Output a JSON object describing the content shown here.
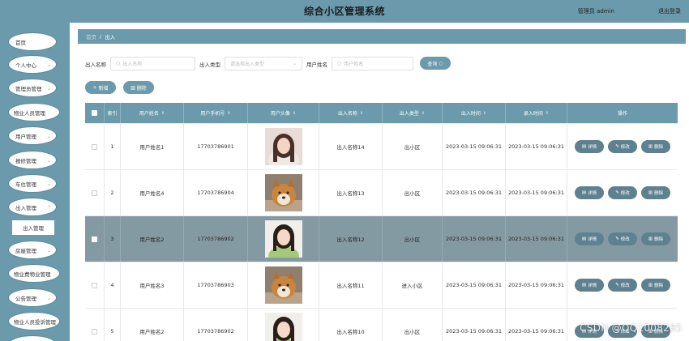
{
  "header": {
    "title": "综合小区管理系统",
    "admin": "管理员 admin",
    "logout": "退出登录"
  },
  "sidebar": {
    "items": [
      {
        "label": "首页"
      },
      {
        "label": "个人中心"
      },
      {
        "label": "管理员管理"
      },
      {
        "label": "物业人员管理"
      },
      {
        "label": "用户管理"
      },
      {
        "label": "报修管理"
      },
      {
        "label": "车位管理"
      },
      {
        "label": "出入管理"
      },
      {
        "label": "出入管理"
      },
      {
        "label": "房屋管理"
      },
      {
        "label": "物业费物业管理"
      },
      {
        "label": "公告管理"
      },
      {
        "label": "物业人员投诉管理"
      }
    ]
  },
  "breadcrumb": {
    "home": "首页",
    "sep": "/",
    "current": "出入"
  },
  "search": {
    "name_label": "出入名称",
    "name_placeholder": "出入名称",
    "type_label": "出入类型",
    "type_placeholder": "请选择出入类型",
    "user_label": "用户姓名",
    "user_placeholder": "用户姓名",
    "query_label": "查询"
  },
  "toolbar": {
    "add_label": "新增",
    "delete_label": "删除"
  },
  "table": {
    "headers": [
      "索引",
      "用户姓名",
      "用户手机号",
      "用户头像",
      "出入名称",
      "出入类型",
      "出入时间",
      "录入时间",
      "操作"
    ],
    "actions": {
      "detail": "详情",
      "edit": "修改",
      "delete": "删除"
    },
    "rows": [
      {
        "index": "1",
        "user": "用户姓名1",
        "phone": "17703786901",
        "name": "出入名称14",
        "type": "出小区",
        "time": "2023-03-15 09:06:31",
        "created": "2023-03-15 09:06:31"
      },
      {
        "index": "2",
        "user": "用户姓名4",
        "phone": "17703786904",
        "name": "出入名称13",
        "type": "出小区",
        "time": "2023-03-15 09:06:31",
        "created": "2023-03-15 09:06:31"
      },
      {
        "index": "3",
        "user": "用户姓名2",
        "phone": "17703786902",
        "name": "出入名称12",
        "type": "出小区",
        "time": "2023-03-15 09:06:31",
        "created": "2023-03-15 09:06:31"
      },
      {
        "index": "4",
        "user": "用户姓名3",
        "phone": "17703786903",
        "name": "出入名称11",
        "type": "进入小区",
        "time": "2023-03-15 09:06:31",
        "created": "2023-03-15 09:06:31"
      },
      {
        "index": "5",
        "user": "用户姓名2",
        "phone": "17703786902",
        "name": "出入名称10",
        "type": "出小区",
        "time": "2023-03-15 09:06:31",
        "created": "2023-03-15 09:06:31"
      }
    ]
  },
  "watermark": "CSDN @QQ1008285",
  "colors": {
    "primary": "#6a9aab",
    "selected_row": "#849aa2",
    "action_button": "#5e8190"
  }
}
